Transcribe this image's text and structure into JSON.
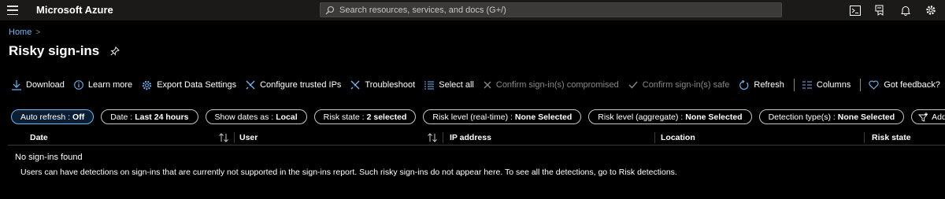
{
  "topbar": {
    "brand": "Microsoft Azure",
    "search_placeholder": "Search resources, services, and docs (G+/)",
    "icons": [
      "cloud-shell-icon",
      "directory-filter-icon",
      "notifications-icon",
      "settings-icon",
      "help-icon"
    ]
  },
  "breadcrumb": {
    "home": "Home",
    "separator": ">"
  },
  "page": {
    "title": "Risky sign-ins"
  },
  "toolbar": {
    "download": "Download",
    "learn_more": "Learn more",
    "export": "Export Data Settings",
    "configure_ips": "Configure trusted IPs",
    "troubleshoot": "Troubleshoot",
    "select_all": "Select all",
    "confirm_compromised": "Confirm sign-in(s) compromised",
    "confirm_safe": "Confirm sign-in(s) safe",
    "refresh": "Refresh",
    "columns": "Columns",
    "feedback": "Got feedback?"
  },
  "filters": [
    {
      "label": "Auto refresh :",
      "value": "Off",
      "active": true
    },
    {
      "label": "Date :",
      "value": "Last 24 hours"
    },
    {
      "label": "Show dates as :",
      "value": "Local"
    },
    {
      "label": "Risk state :",
      "value": "2 selected"
    },
    {
      "label": "Risk level (real-time) :",
      "value": "None Selected"
    },
    {
      "label": "Risk level (aggregate) :",
      "value": "None Selected"
    },
    {
      "label": "Detection type(s) :",
      "value": "None Selected"
    }
  ],
  "add_filters": "Add filters",
  "table": {
    "columns": [
      "Date",
      "User",
      "IP address",
      "Location",
      "Risk state"
    ],
    "empty_text": "No sign-ins found",
    "note": "Users can have detections on sign-ins that are currently not supported in the sign-ins report. Such risky sign-ins do not appear here. To see all the detections, go to Risk detections."
  },
  "colors": {
    "accent": "#6cb8f6",
    "topbar": "#1b1a19",
    "background": "#000000"
  }
}
